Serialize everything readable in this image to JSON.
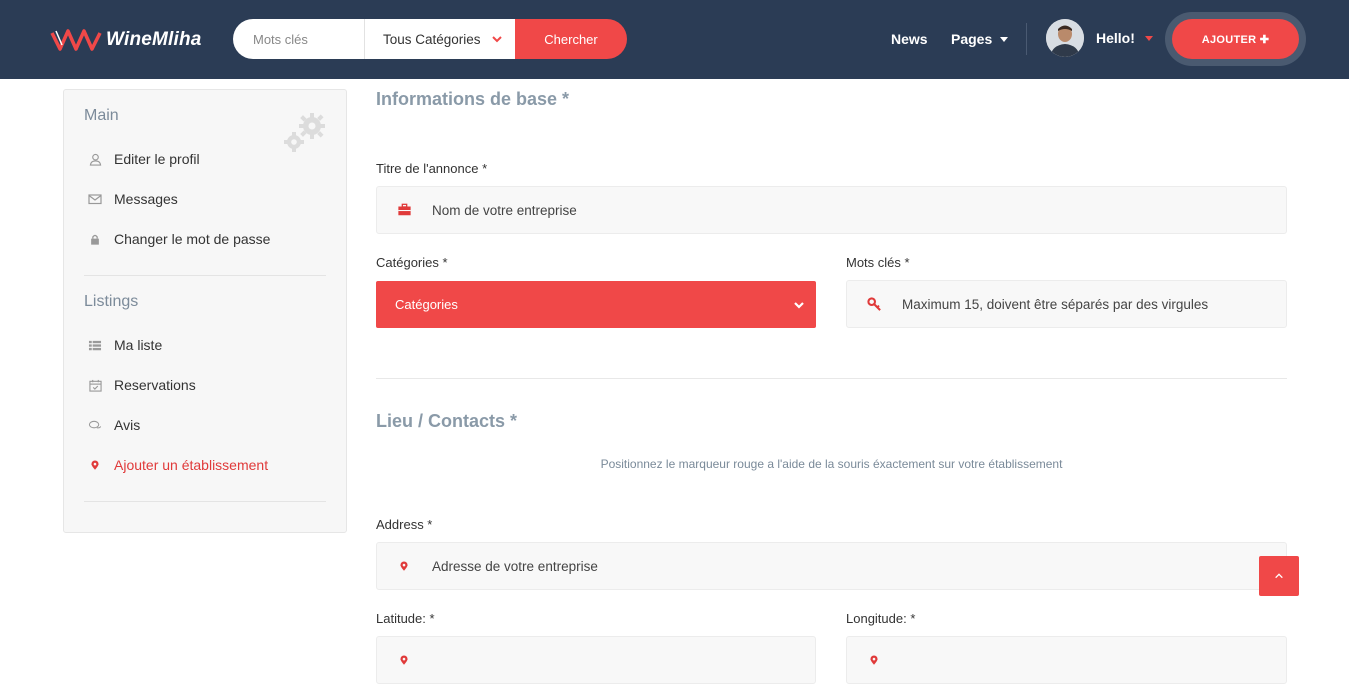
{
  "header": {
    "logo_text": "WineMliha",
    "search": {
      "keywords_placeholder": "Mots clés",
      "category_value": "Tous Catégories",
      "submit_label": "Chercher"
    },
    "nav": {
      "news_label": "News",
      "pages_label": "Pages"
    },
    "user": {
      "greeting": "Hello!"
    },
    "add_label": "AJOUTER ✚"
  },
  "sidebar": {
    "main_heading": "Main",
    "main_items": [
      {
        "label": "Editer le profil",
        "icon": "user-icon"
      },
      {
        "label": "Messages",
        "icon": "envelope-icon"
      },
      {
        "label": "Changer le mot de passe",
        "icon": "lock-icon"
      }
    ],
    "listings_heading": "Listings",
    "listing_items": [
      {
        "label": "Ma liste",
        "icon": "list-icon"
      },
      {
        "label": "Reservations",
        "icon": "calendar-check-icon"
      },
      {
        "label": "Avis",
        "icon": "comments-icon"
      },
      {
        "label": "Ajouter un établissement",
        "icon": "map-marker-icon",
        "active": true
      }
    ]
  },
  "form": {
    "basic_title": "Informations de base *",
    "listing_title_label": "Titre de l'annonce *",
    "listing_title_placeholder": "Nom de votre entreprise",
    "categories_label": "Catégories *",
    "categories_value": "Catégories",
    "keywords_label": "Mots clés *",
    "keywords_placeholder": "Maximum 15, doivent être séparés par des virgules",
    "location_title": "Lieu / Contacts *",
    "location_hint": "Positionnez le marqueur rouge a l'aide de la souris éxactement sur votre établissement",
    "address_label": "Address *",
    "address_placeholder": "Adresse de votre entreprise",
    "latitude_label": "Latitude: *",
    "longitude_label": "Longitude: *"
  },
  "colors": {
    "header_bg": "#2b3c55",
    "accent": "#f04848",
    "muted_heading": "#8a9aa8",
    "sidebar_bg": "#f7f7f7"
  }
}
